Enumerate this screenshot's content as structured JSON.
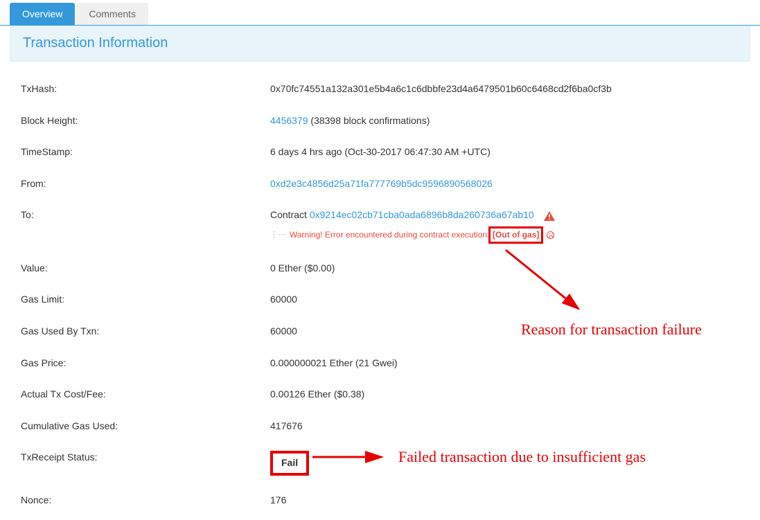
{
  "tabs": {
    "overview": "Overview",
    "comments": "Comments"
  },
  "section_title": "Transaction Information",
  "labels": {
    "txhash": "TxHash:",
    "block_height": "Block Height:",
    "timestamp": "TimeStamp:",
    "from": "From:",
    "to": "To:",
    "value": "Value:",
    "gas_limit": "Gas Limit:",
    "gas_used": "Gas Used By Txn:",
    "gas_price": "Gas Price:",
    "actual_cost": "Actual Tx Cost/Fee:",
    "cum_gas": "Cumulative Gas Used:",
    "receipt": "TxReceipt Status:",
    "nonce": "Nonce:"
  },
  "values": {
    "txhash": "0x70fc74551a132a301e5b4a6c1c6dbbfe23d4a6479501b60c6468cd2f6ba0cf3b",
    "block_height_link": "4456379",
    "block_height_conf": " (38398 block confirmations)",
    "timestamp": "6 days 4 hrs ago (Oct-30-2017 06:47:30 AM +UTC)",
    "from": "0xd2e3c4856d25a71fa777769b5dc9596890568026",
    "to_prefix": "Contract ",
    "to_addr": "0x9214ec02cb71cba0ada6896b8da260736a67ab10",
    "warn_text": "Warning! Error encountered during contract execution ",
    "warn_bracket_open": "[",
    "warn_reason": "Out of gas",
    "warn_bracket_close": "]",
    "value": "0 Ether ($0.00)",
    "gas_limit": "60000",
    "gas_used": "60000",
    "gas_price": "0.000000021 Ether (21 Gwei)",
    "actual_cost": "0.00126 Ether ($0.38)",
    "cum_gas": "417676",
    "receipt": "Fail",
    "nonce": "176"
  },
  "annotations": {
    "reason": "Reason for transaction failure",
    "failed": "Failed transaction due to insufficient gas"
  }
}
